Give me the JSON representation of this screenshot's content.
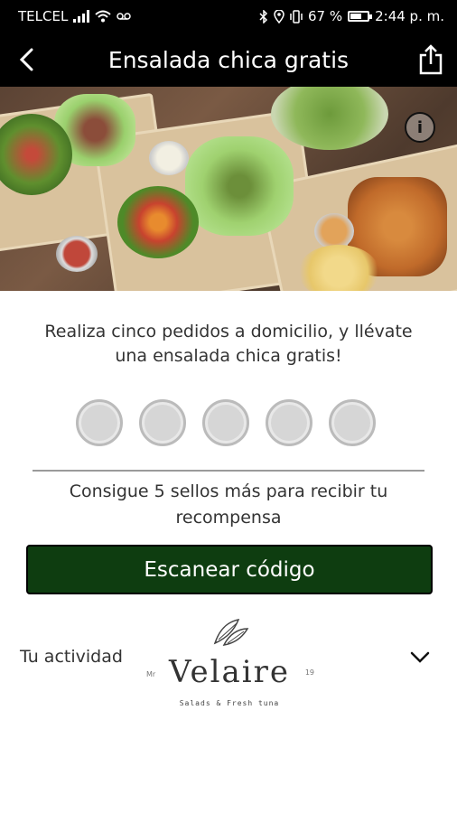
{
  "status_bar": {
    "carrier": "TELCEL",
    "battery_percent": "67 %",
    "time": "2:44 p. m.",
    "battery_fill": 0.67
  },
  "header": {
    "title": "Ensalada chica gratis",
    "back_icon": "chevron-left-icon",
    "share_icon": "share-icon"
  },
  "hero": {
    "info_glyph": "i"
  },
  "reward": {
    "description": "Realiza cinco pedidos a domicilio, y llévate una ensalada chica gratis!",
    "stamps_total": 5,
    "stamps_collected": 0,
    "remaining_text": "Consigue 5 sellos más para recibir tu recompensa",
    "scan_button_label": "Escanear código",
    "button_color": "#0e3d10"
  },
  "activity": {
    "label": "Tu actividad",
    "expand_icon": "chevron-down-icon"
  },
  "brand": {
    "name": "Velaire",
    "prefix": "Mr",
    "suffix": "19",
    "tagline": "Salads & Fresh tuna"
  }
}
